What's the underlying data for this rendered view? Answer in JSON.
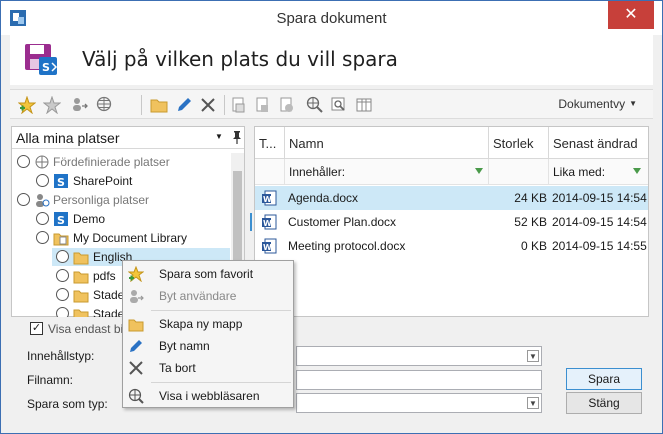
{
  "window": {
    "title": "Spara dokument",
    "close": "✕"
  },
  "banner": {
    "title": "Välj på vilken plats du vill spara"
  },
  "toolbar": {
    "view_label": "Dokumentvy",
    "view_caret": "▼"
  },
  "location": {
    "label": "Alla mina platser",
    "caret": "▼"
  },
  "tree": [
    {
      "label": "Fördefinierade platser",
      "icon": "globe-icon"
    },
    {
      "label": "SharePoint",
      "icon": "sharepoint-icon"
    },
    {
      "label": "Personliga platser",
      "icon": "personal-icon"
    },
    {
      "label": "Demo",
      "icon": "sharepoint-icon"
    },
    {
      "label": "My Document Library",
      "icon": "library-icon"
    },
    {
      "label": "English",
      "icon": "folder-icon"
    },
    {
      "label": "pdfs",
      "icon": "folder-icon"
    },
    {
      "label": "Stade",
      "icon": "folder-icon"
    },
    {
      "label": "Stade",
      "icon": "folder-icon"
    }
  ],
  "grid": {
    "headers": {
      "type": "T...",
      "name": "Namn",
      "size": "Storlek",
      "modified": "Senast ändrad"
    },
    "filters": {
      "contains": "Innehåller:",
      "equals": "Lika med:"
    },
    "rows": [
      {
        "name": "Agenda.docx",
        "size": "24 KB",
        "modified": "2014-09-15 14:54"
      },
      {
        "name": "Customer Plan.docx",
        "size": "52 KB",
        "modified": "2014-09-15 14:54"
      },
      {
        "name": "Meeting protocol.docx",
        "size": "0 KB",
        "modified": "2014-09-15 14:55"
      }
    ]
  },
  "bottom": {
    "checkbox_label": "Visa endast bil",
    "checkbox_mark": "✓",
    "content_type_label": "Innehållstyp:",
    "filename_label": "Filnamn:",
    "save_as_label": "Spara som typ:",
    "save_button": "Spara",
    "close_button": "Stäng",
    "dd_caret": "▼"
  },
  "context_menu": [
    {
      "label": "Spara som favorit",
      "icon": "star-add-icon",
      "enabled": true
    },
    {
      "label": "Byt användare",
      "icon": "switch-user-icon",
      "enabled": false
    },
    {
      "label": "Skapa ny mapp",
      "icon": "new-folder-icon",
      "enabled": true
    },
    {
      "label": "Byt namn",
      "icon": "rename-pencil-icon",
      "enabled": true
    },
    {
      "label": "Ta bort",
      "icon": "delete-x-icon",
      "enabled": true
    },
    {
      "label": "Visa i webbläsaren",
      "icon": "browser-globe-icon",
      "enabled": true
    }
  ],
  "colors": {
    "selection": "#cde8f7",
    "close_red": "#c7403a",
    "accent_blue": "#3c8fd0",
    "word_blue": "#2b579a",
    "folder_yellow": "#f0c25e"
  }
}
